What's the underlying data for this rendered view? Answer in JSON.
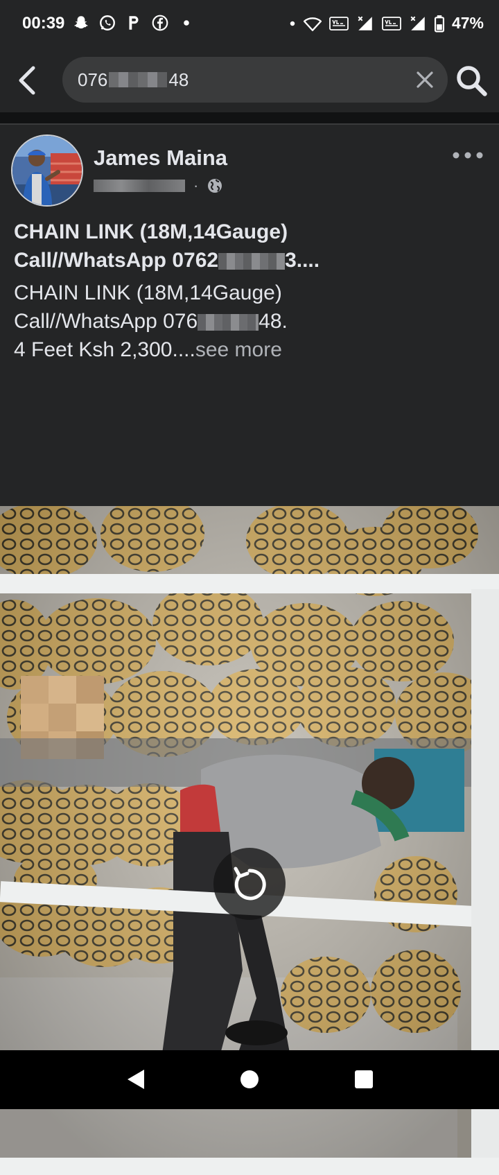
{
  "status_bar": {
    "time": "00:39",
    "battery": "47%",
    "left_icons": [
      "snapchat-icon",
      "whatsapp-icon",
      "p-icon",
      "facebook-icon"
    ],
    "right_icons": [
      "wifi-icon",
      "volte-icon",
      "signal-icon",
      "volte-icon",
      "signal-icon",
      "battery-icon"
    ]
  },
  "search": {
    "value_prefix": "076",
    "value_suffix": "48"
  },
  "post": {
    "author": "James Maina",
    "title_line1": "CHAIN LINK (18M,14Gauge)",
    "title_line2_prefix": "Call//WhatsApp 0762",
    "title_line2_suffix": "3....",
    "body_line1": "CHAIN LINK (18M,14Gauge)",
    "body_line2_prefix": "Call//WhatsApp 076",
    "body_line2_suffix": "48.",
    "body_line3": "4 Feet Ksh 2,300....",
    "see_more": "see more"
  },
  "colors": {
    "background": "#18191a",
    "surface": "#242526",
    "search_field": "#3a3b3c",
    "text_primary": "#e4e6eb",
    "text_secondary": "#b0b3b8"
  }
}
